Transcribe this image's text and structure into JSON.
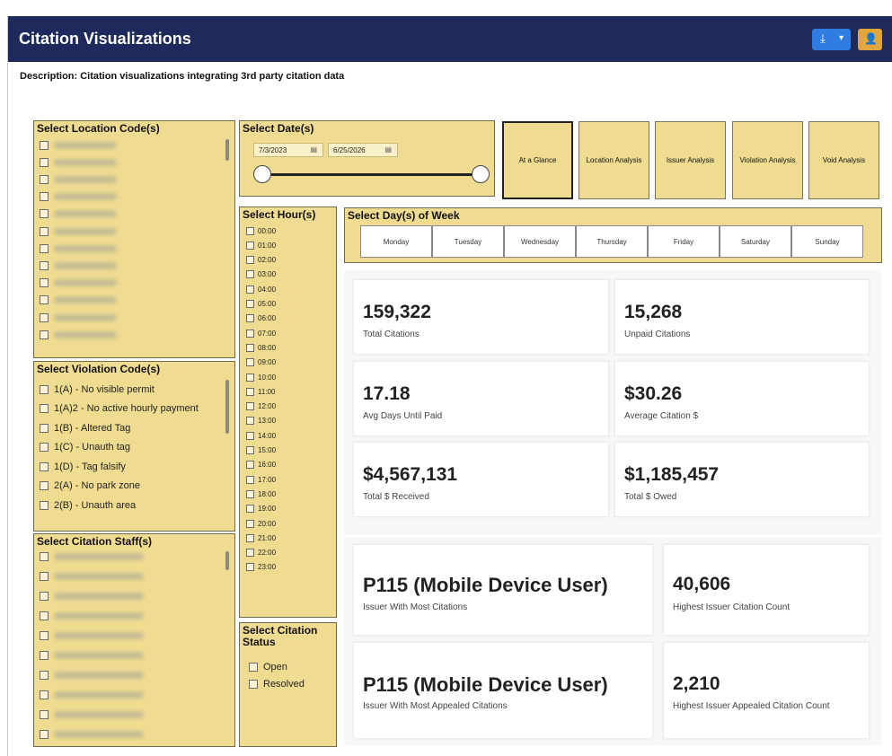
{
  "app": {
    "title": "Citation Visualizations",
    "description": "Description: Citation visualizations integrating 3rd party citation data",
    "download_icon": "download-icon",
    "download_caret": "▾",
    "user_icon": "user-settings-icon"
  },
  "colors": {
    "header_bg": "#1f2a5c",
    "panel_bg": "#f0dc91",
    "download_btn": "#2f7de1",
    "user_btn": "#e2a73b"
  },
  "location_panel": {
    "title": "Select Location Code(s)",
    "items": [
      "",
      "",
      "",
      "",
      "",
      "",
      "",
      "",
      "",
      "",
      "",
      ""
    ]
  },
  "violation_panel": {
    "title": "Select Violation Code(s)",
    "items": [
      "1(A) - No visible permit",
      "1(A)2 - No active hourly payment",
      "1(B) - Altered Tag",
      "1(C) - Unauth tag",
      "1(D) - Tag falsify",
      "2(A) - No park zone",
      "2(B) - Unauth area"
    ]
  },
  "staff_panel": {
    "title": "Select Citation Staff(s)",
    "items": [
      "",
      "",
      "",
      "",
      "",
      "",
      "",
      "",
      "",
      ""
    ]
  },
  "date_panel": {
    "title": "Select Date(s)",
    "start": "7/3/2023",
    "end": "6/25/2026",
    "calendar_icon": "calendar-icon"
  },
  "hour_panel": {
    "title": "Select Hour(s)",
    "hours": [
      "00:00",
      "01:00",
      "02:00",
      "03:00",
      "04:00",
      "05:00",
      "06:00",
      "07:00",
      "08:00",
      "09:00",
      "10:00",
      "11:00",
      "12:00",
      "13:00",
      "14:00",
      "15:00",
      "16:00",
      "17:00",
      "18:00",
      "19:00",
      "20:00",
      "21:00",
      "22:00",
      "23:00"
    ]
  },
  "status_panel": {
    "title_line1": "Select Citation",
    "title_line2": "Status",
    "items": [
      "Open",
      "Resolved"
    ]
  },
  "nav": [
    "At a Glance",
    "Location Analysis",
    "Issuer Analysis",
    "Violation Analysis",
    "Void Analysis"
  ],
  "dow_panel": {
    "title": "Select Day(s) of Week",
    "days": [
      "Monday",
      "Tuesday",
      "Wednesday",
      "Thursday",
      "Friday",
      "Saturday",
      "Sunday"
    ]
  },
  "kpis": [
    {
      "value": "159,322",
      "label": "Total Citations"
    },
    {
      "value": "15,268",
      "label": "Unpaid Citations"
    },
    {
      "value": "17.18",
      "label": "Avg Days Until Paid"
    },
    {
      "value": "$30.26",
      "label": "Average Citation $"
    },
    {
      "value": "$4,567,131",
      "label": "Total $ Received"
    },
    {
      "value": "$1,185,457",
      "label": "Total $ Owed"
    }
  ],
  "issuer": [
    {
      "value": "P115 (Mobile Device User)",
      "label": "Issuer With Most Citations"
    },
    {
      "value": "40,606",
      "label": "Highest Issuer Citation Count"
    },
    {
      "value": "P115 (Mobile Device User)",
      "label": "Issuer With Most Appealed Citations"
    },
    {
      "value": "2,210",
      "label": "Highest Issuer Appealed Citation Count"
    }
  ]
}
